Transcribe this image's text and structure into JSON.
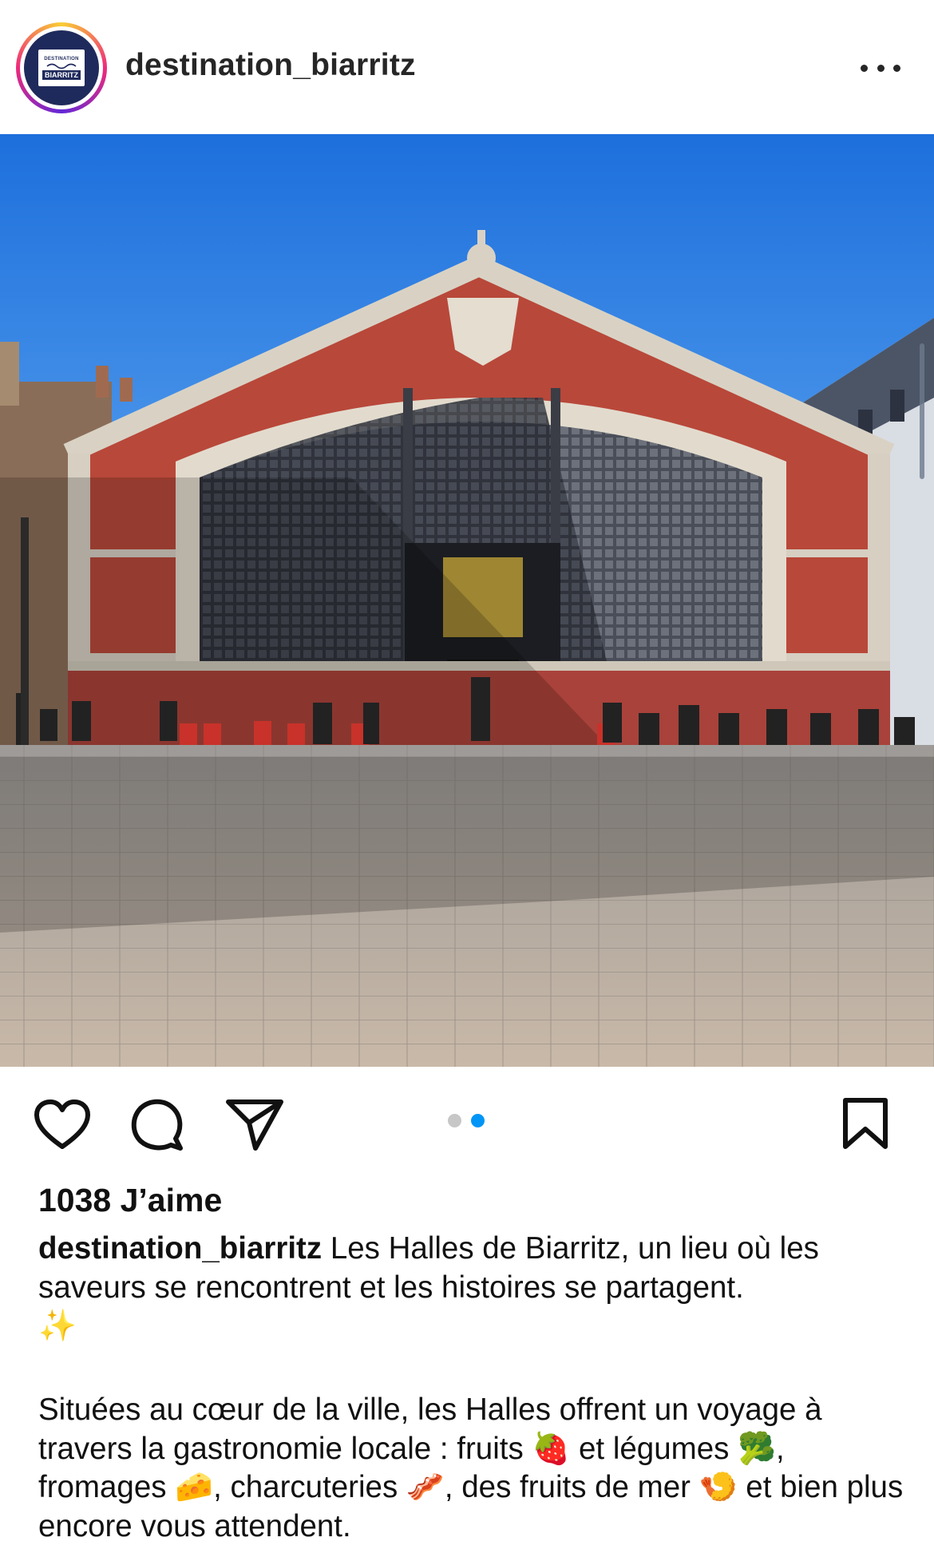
{
  "post": {
    "username": "destination_biarritz",
    "avatar": {
      "line1": "DESTINATION",
      "line2": "BIARRITZ",
      "color": "#1f2a5c"
    },
    "more_icon": "more-horizontal-icon",
    "carousel": {
      "total": 2,
      "active_index": 2,
      "active_color": "#0095f6"
    },
    "actions": {
      "like_icon": "heart-icon",
      "comment_icon": "comment-icon",
      "share_icon": "send-icon",
      "save_icon": "bookmark-icon"
    },
    "likes_label": "1038 J’aime",
    "caption": {
      "username": "destination_biarritz",
      "line1_text": " Les Halles de Biarritz, un lieu où les saveurs se rencontrent et les histoires se partagent.",
      "sparkles": "✨",
      "para2_a": "Situées au cœur de la ville, les Halles offrent un voyage à travers la gastronomie locale : fruits ",
      "strawberry": "🍓",
      "para2_b": " et légumes ",
      "broccoli": "🥦",
      "para2_c": ", fromages ",
      "cheese": "🧀",
      "para2_d": ", charcuteries ",
      "bacon": "🥓",
      "para2_e": ", des fruits de mer ",
      "shrimp": "🍤",
      "para2_f": " et bien plus encore vous attendent."
    }
  }
}
